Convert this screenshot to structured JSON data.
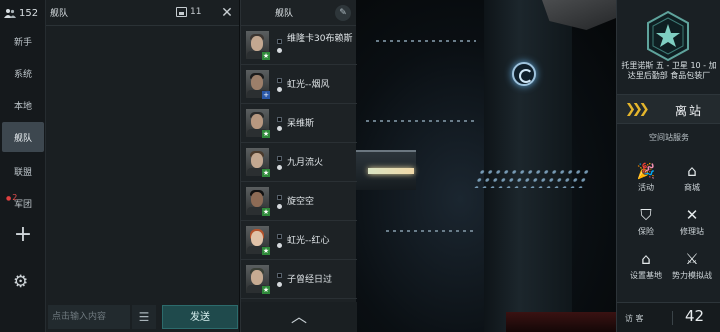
{
  "nav": {
    "online_count": "152",
    "items": [
      {
        "label": "新手"
      },
      {
        "label": "系统"
      },
      {
        "label": "本地"
      },
      {
        "label": "舰队"
      },
      {
        "label": "联盟"
      },
      {
        "label": "军团",
        "badge": "2"
      }
    ],
    "active_item": "舰队",
    "add_icon": "plus-icon",
    "settings_icon": "gear-icon"
  },
  "chat": {
    "title": "舰队",
    "member_count": "11",
    "input_placeholder": "点击输入内容",
    "send_label": "发送",
    "menu_icon": "list-icon",
    "close_icon": "close-icon"
  },
  "fleet": {
    "title": "舰队",
    "edit_icon": "edit-icon",
    "collapse_icon": "chevron-up-icon",
    "members": [
      {
        "name": "维隆卡30布赖斯",
        "role": "star"
      },
      {
        "name": "虹光--烟风",
        "role": "plus"
      },
      {
        "name": "呆维斯",
        "role": "star"
      },
      {
        "name": "九月流火",
        "role": "star"
      },
      {
        "name": "旋空空",
        "role": "star"
      },
      {
        "name": "虹光--红心",
        "role": "star"
      },
      {
        "name": "子曾经日过",
        "role": "star"
      }
    ]
  },
  "station": {
    "name": "托里诺斯 五 - 卫星 10 - 加达里后勤部 食品包装厂",
    "undock_label": "离站",
    "services_title": "空间站服务",
    "services": [
      {
        "label": "活动",
        "icon": "party-icon"
      },
      {
        "label": "商城",
        "icon": "store-icon"
      },
      {
        "label": "保险",
        "icon": "shield-icon"
      },
      {
        "label": "修理站",
        "icon": "wrench-icon"
      },
      {
        "label": "设置基地",
        "icon": "home-icon"
      },
      {
        "label": "势力模拟战",
        "icon": "sword-icon"
      }
    ],
    "visitors_label": "访 客",
    "visitors_count": "42",
    "accent_color": "#e4b52c"
  }
}
